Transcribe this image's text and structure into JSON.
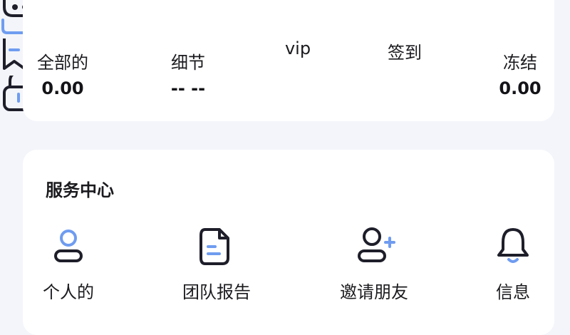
{
  "stats": [
    {
      "label": "全部的",
      "value": "0.00",
      "icon": "wallet-icon"
    },
    {
      "label": "细节",
      "value": "-- --",
      "icon": "bookmark-icon"
    },
    {
      "label": "vip",
      "value": ""
    },
    {
      "label": "签到",
      "value": ""
    },
    {
      "label": "冻结",
      "value": "0.00",
      "icon": "lock-icon"
    }
  ],
  "service": {
    "title": "服务中心",
    "items": [
      {
        "label": "个人的",
        "icon": "user-icon"
      },
      {
        "label": "团队报告",
        "icon": "document-icon"
      },
      {
        "label": "邀请朋友",
        "icon": "add-user-icon"
      },
      {
        "label": "信息",
        "icon": "bell-icon"
      }
    ]
  },
  "colors": {
    "accent": "#6f9cf0",
    "icon_dark": "#1e1e2a",
    "background": "#f3f5fa",
    "card": "#ffffff"
  }
}
